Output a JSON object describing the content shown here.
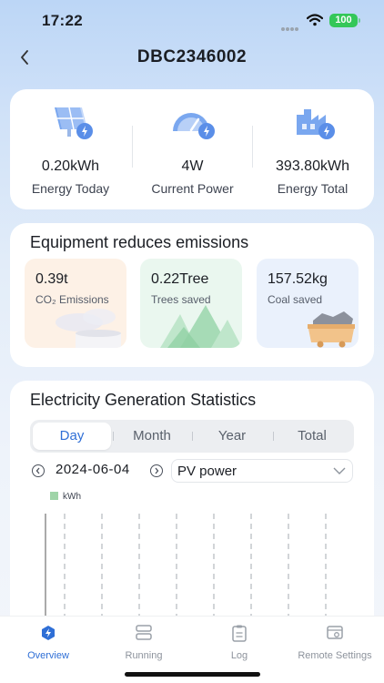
{
  "status_bar": {
    "time": "17:22",
    "battery": "100"
  },
  "header": {
    "title": "DBC2346002",
    "back_icon": "chevron-left-icon"
  },
  "energy": [
    {
      "value": "0.20kWh",
      "label": "Energy Today",
      "icon": "solar-panel-icon"
    },
    {
      "value": "4W",
      "label": "Current Power",
      "icon": "speedometer-icon"
    },
    {
      "value": "393.80kWh",
      "label": "Energy Total",
      "icon": "factory-bolt-icon"
    }
  ],
  "emissions": {
    "title": "Equipment reduces emissions",
    "items": [
      {
        "value": "0.39t",
        "label": "CO₂ Emissions",
        "bg": "#fdf1e6",
        "icon": "cloud-smoke-icon"
      },
      {
        "value": "0.22Tree",
        "label": "Trees saved",
        "bg": "#eaf7ef",
        "icon": "trees-icon"
      },
      {
        "value": "157.52kg",
        "label": "Coal saved",
        "bg": "#eaf1fc",
        "icon": "coal-cart-icon"
      }
    ]
  },
  "stats": {
    "title": "Electricity Generation Statistics",
    "tabs": [
      "Day",
      "Month",
      "Year",
      "Total"
    ],
    "active_tab": "Day",
    "date": "2024-06-04",
    "power_select": "PV power",
    "legend": "kWh"
  },
  "tabbar": [
    {
      "label": "Overview",
      "icon": "bolt-hex-icon",
      "active": true
    },
    {
      "label": "Running",
      "icon": "server-icon",
      "active": false
    },
    {
      "label": "Log",
      "icon": "clipboard-icon",
      "active": false
    },
    {
      "label": "Remote Settings",
      "icon": "settings-window-icon",
      "active": false
    }
  ],
  "colors": {
    "accent": "#2f6fd6",
    "legend_green": "#9fd4a8"
  }
}
